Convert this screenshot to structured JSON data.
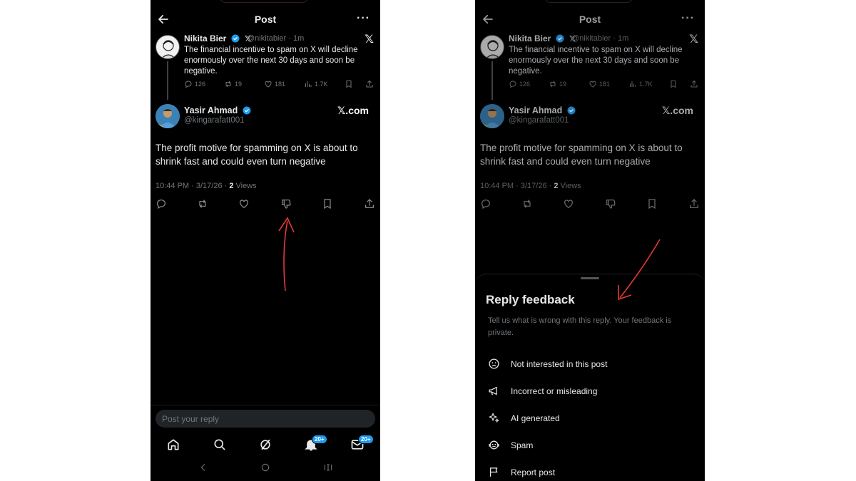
{
  "header": {
    "title": "Post",
    "more": "···"
  },
  "quoted_post": {
    "author_name": "Nikita Bier",
    "handle_time": "@nikitabier · 1m",
    "text": "The financial incentive to spam on X will decline enormously over the next 30 days and soon be negative.",
    "stats": {
      "replies": "126",
      "reposts": "19",
      "likes": "181",
      "views": "1.7K"
    }
  },
  "reply_post": {
    "author_name": "Yasir Ahmad",
    "handle": "@kingarafatt001",
    "source": "𝕏.com",
    "text": "The profit motive for spamming on X is about to shrink fast  and could even turn negative",
    "timestamp": "10:44 PM · 3/17/26 · ",
    "views_count": "2",
    "views_label": " Views"
  },
  "reply_input": {
    "placeholder": "Post your reply"
  },
  "nav": {
    "notifications_badge": "20+",
    "messages_badge": "20+"
  },
  "sheet": {
    "title": "Reply feedback",
    "description": "Tell us what is wrong with this reply. Your feedback is private.",
    "options": [
      {
        "label": "Not interested in this post",
        "icon": "sad-face-icon"
      },
      {
        "label": "Incorrect or misleading",
        "icon": "megaphone-icon"
      },
      {
        "label": "AI generated",
        "icon": "sparkle-icon"
      },
      {
        "label": "Spam",
        "icon": "robot-icon"
      },
      {
        "label": "Report post",
        "icon": "flag-icon"
      }
    ]
  },
  "colors": {
    "background": "#000000",
    "text": "#e7e9ea",
    "muted": "#71767b",
    "accent": "#1d9bf0",
    "annotation": "#e53935"
  }
}
